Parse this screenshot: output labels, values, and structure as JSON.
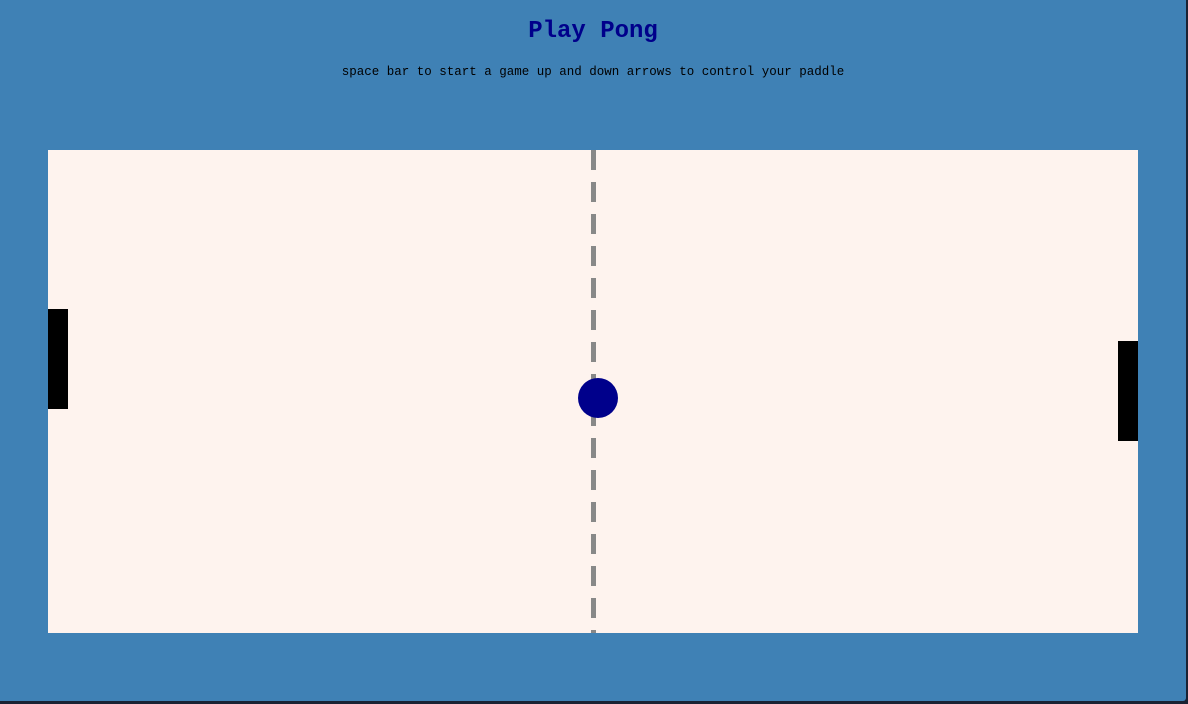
{
  "header": {
    "title": "Play Pong",
    "instructions": "space bar to start a game up and down arrows to control your paddle"
  },
  "colors": {
    "background": "#3f81b5",
    "court": "#fef3ee",
    "title": "#00008b",
    "ball": "#00008b",
    "paddle": "#000000",
    "center_line": "#888888"
  },
  "game": {
    "left_paddle": {
      "icon": "paddle"
    },
    "right_paddle": {
      "icon": "paddle"
    },
    "ball": {
      "icon": "ball"
    }
  }
}
